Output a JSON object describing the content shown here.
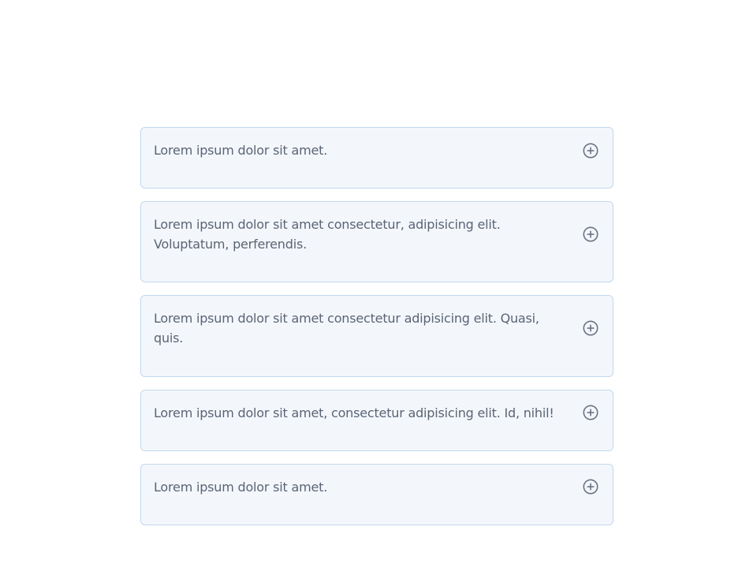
{
  "faq": {
    "items": [
      {
        "question": "Lorem ipsum dolor sit amet.",
        "icon": "plus-circle-icon",
        "expanded": false
      },
      {
        "question": "Lorem ipsum dolor sit amet consectetur, adipisicing elit. Voluptatum, perferendis.",
        "icon": "plus-circle-icon",
        "expanded": false
      },
      {
        "question": "Lorem ipsum dolor sit amet consectetur adipisicing elit. Quasi, quis.",
        "icon": "plus-circle-icon",
        "expanded": false
      },
      {
        "question": "Lorem ipsum dolor sit amet, consectetur adipisicing elit. Id, nihil!",
        "icon": "plus-circle-icon",
        "expanded": false
      },
      {
        "question": "Lorem ipsum dolor sit amet.",
        "icon": "plus-circle-icon",
        "expanded": false
      }
    ]
  },
  "colors": {
    "item_background": "#f3f7fc",
    "item_border": "#c3d8ee",
    "text": "#5b6474",
    "icon": "#6b7280"
  }
}
